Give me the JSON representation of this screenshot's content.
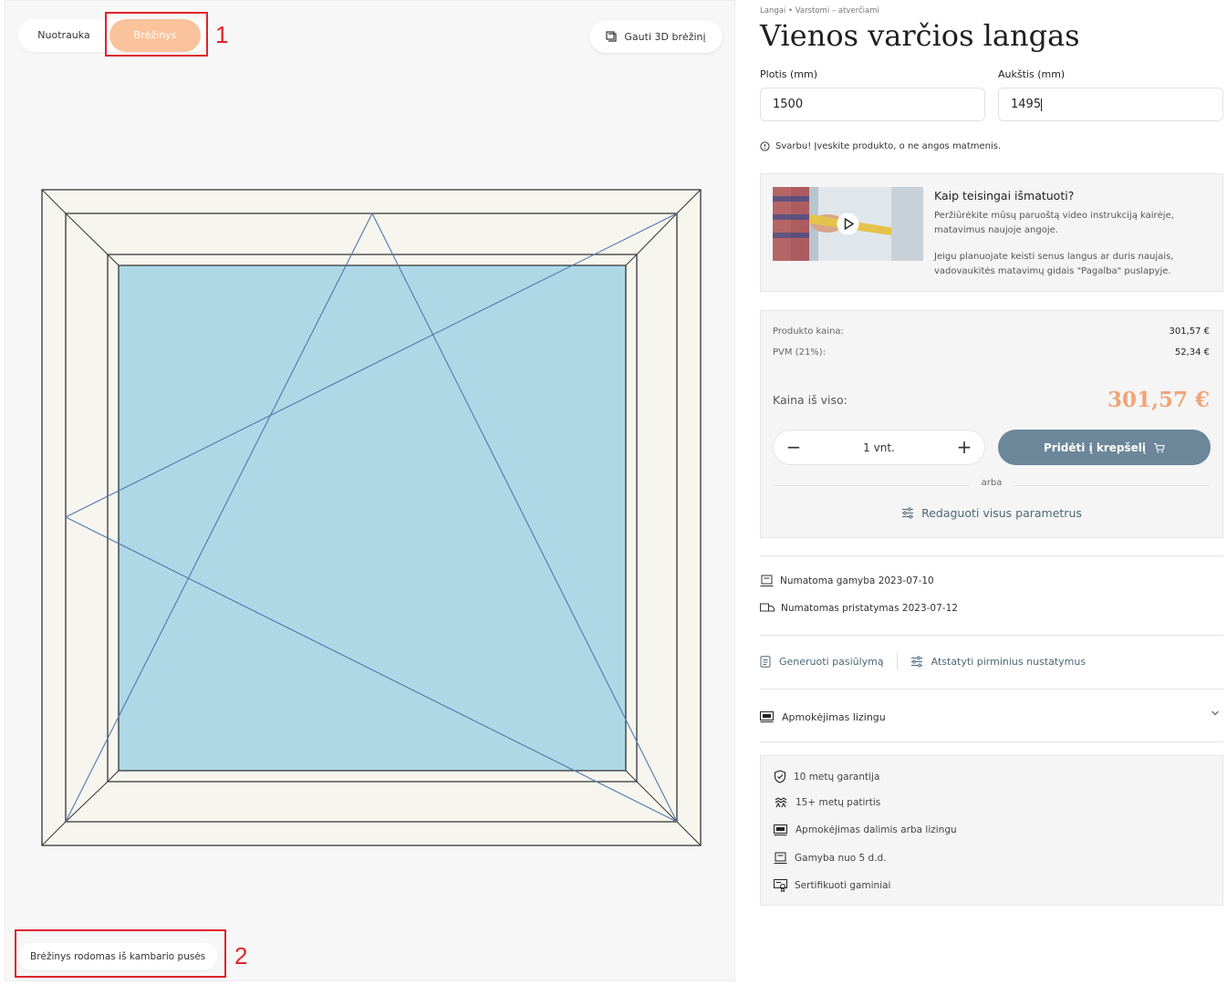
{
  "view_toggle": {
    "photo_label": "Nuotrauka",
    "drawing_label": "Brėžinys"
  },
  "annotations": {
    "first": "1",
    "second": "2"
  },
  "btn_3d": {
    "label": "Gauti 3D brėžinį"
  },
  "drawing_note": "Brėžinys rodomas iš kambario pusės",
  "colors": {
    "accent_orange": "#fbc39c",
    "price_orange": "#f2a477",
    "primary_blue": "#6b8799",
    "glass": "#add8e6",
    "frame": "#f6f6ee",
    "annotation_red": "#e0232b"
  },
  "breadcrumb": "Langai  •  Varstomi – atverčiami",
  "product_title": "Vienos varčios langas",
  "dimensions": {
    "width_label": "Plotis (mm)",
    "width_value": "1500",
    "height_label": "Aukštis (mm)",
    "height_value": "1495"
  },
  "notice": "Svarbu! Įveskite produkto, o ne angos matmenis.",
  "video": {
    "title": "Kaip teisingai išmatuoti?",
    "text1": "Peržiūrėkite mūsų paruoštą video instrukciją kairėje, matavimus naujoje angoje.",
    "text2": "Jeigu planuojate keisti senus langus ar duris naujais, vadovaukitės matavimų gidais \"Pagalba\" puslapyje."
  },
  "pricing": {
    "product_price_label": "Produkto kaina:",
    "product_price_value": "301,57 €",
    "vat_label": "PVM (21%):",
    "vat_value": "52,34 €",
    "total_label": "Kaina iš viso:",
    "total_value": "301,57 €"
  },
  "cart": {
    "quantity": "1  vnt.",
    "minus": "−",
    "plus": "+",
    "add_label": "Pridėti į krepšelį",
    "or_label": "arba",
    "edit_label": "Redaguoti visus parametrus"
  },
  "production": {
    "manufacture": "Numatoma gamyba 2023-07-10",
    "delivery": "Numatomas pristatymas 2023-07-12"
  },
  "actions": {
    "generate": "Generuoti pasiūlymą",
    "reset": "Atstatyti pirminius nustatymus"
  },
  "leasing": {
    "label": "Apmokėjimas lizingu"
  },
  "features": [
    {
      "icon": "shield-check-icon",
      "label": "10 metų garantija"
    },
    {
      "icon": "experience-icon",
      "label": "15+ metų patirtis"
    },
    {
      "icon": "payment-icon",
      "label": "Apmokėjimas dalimis arba lizingu"
    },
    {
      "icon": "production-icon",
      "label": "Gamyba nuo 5 d.d."
    },
    {
      "icon": "certificate-icon",
      "label": "Sertifikuoti gaminiai"
    }
  ]
}
